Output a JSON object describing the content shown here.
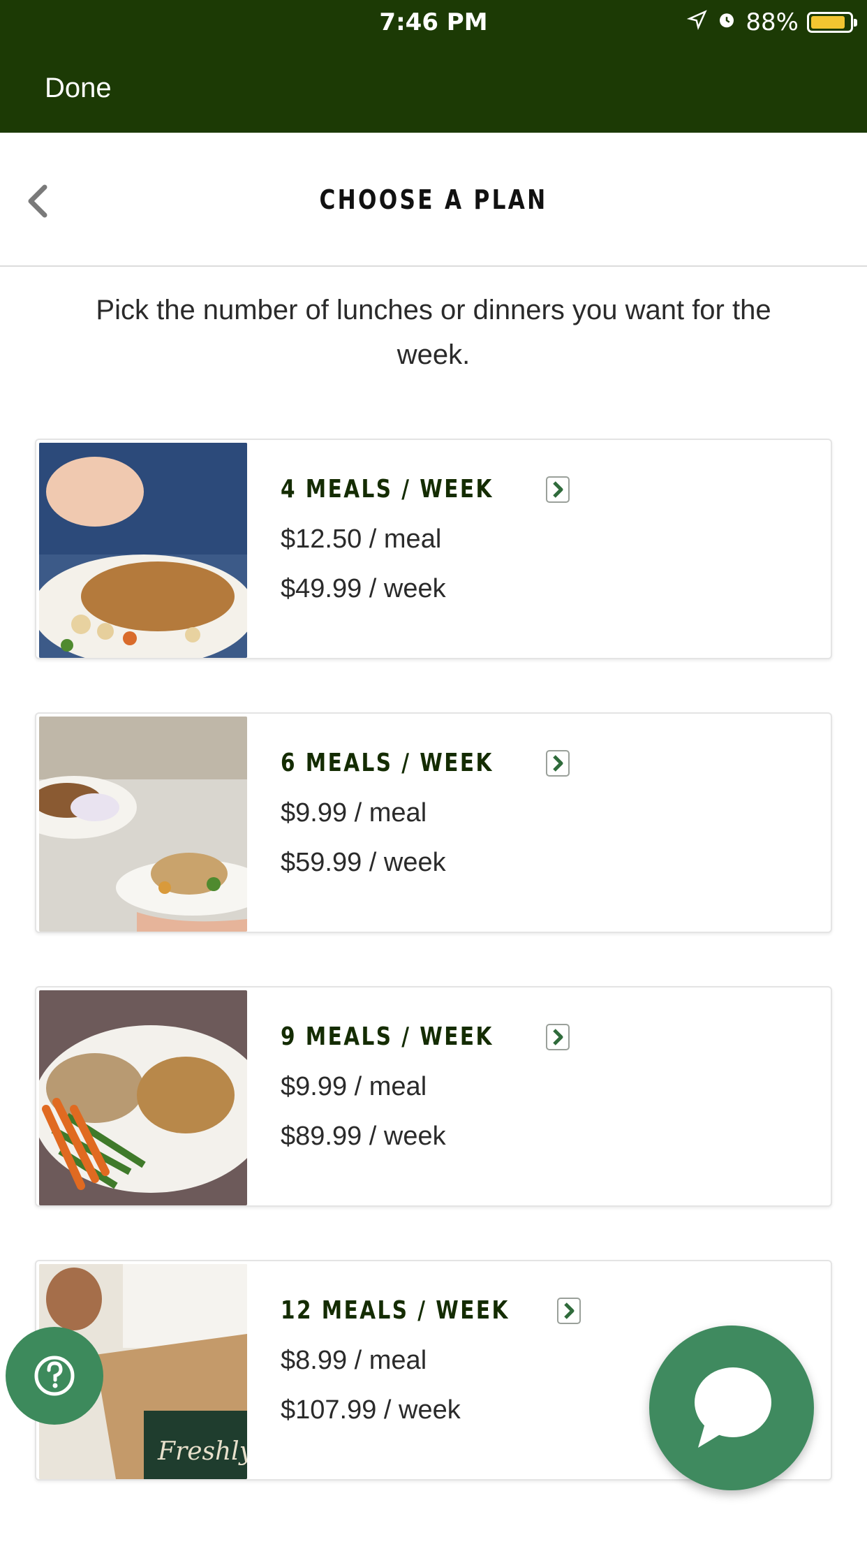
{
  "status_bar": {
    "time": "7:46 PM",
    "battery": "88%",
    "battery_level": 0.88
  },
  "header": {
    "done_label": "Done",
    "title": "CHOOSE A PLAN"
  },
  "subtitle": "Pick the number of lunches or dinners you want for the week.",
  "plans": [
    {
      "meals": "4 MEALS / WEEK",
      "per_meal": "$12.50 / meal",
      "per_week": "$49.99 / week",
      "image": "chicken-plate-photo"
    },
    {
      "meals": "6 MEALS / WEEK",
      "per_meal": "$9.99 / meal",
      "per_week": "$59.99 / week",
      "image": "plates-in-kitchen-photo"
    },
    {
      "meals": "9 MEALS / WEEK",
      "per_meal": "$9.99 / meal",
      "per_week": "$89.99 / week",
      "image": "carrots-beans-plate-photo"
    },
    {
      "meals": "12 MEALS / WEEK",
      "per_meal": "$8.99 / meal",
      "per_week": "$107.99 / week",
      "image": "freshly-box-photo"
    }
  ],
  "floating": {
    "help_icon": "question-circle-icon",
    "chat_icon": "chat-bubble-icon"
  },
  "colors": {
    "header_bg": "#1c3a05",
    "accent_green": "#3f8a5f",
    "title_dark": "#142c02"
  }
}
